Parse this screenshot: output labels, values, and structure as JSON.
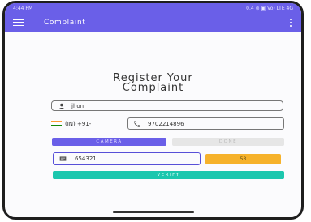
{
  "status_bar": {
    "time": "4:44 PM",
    "right": "0.4 ⊚ ▣ Vo) LTE 4G"
  },
  "app_bar": {
    "title": "Complaint"
  },
  "heading": {
    "line1": "Register Your",
    "line2": "Complaint"
  },
  "name_field": {
    "value": "jhon"
  },
  "phone": {
    "country_prefix": "(IN) +91-",
    "value": "9702214896"
  },
  "buttons": {
    "camera": "CAMERA",
    "done": "DONE",
    "timer": "53",
    "verify": "VERIFY"
  },
  "otp_field": {
    "value": "654321"
  },
  "colors": {
    "primary": "#6a5fe8",
    "verify": "#1cc7ae",
    "timer": "#f6b22b"
  },
  "icons": [
    "menu-icon",
    "more-vert-icon",
    "person-icon",
    "india-flag-icon",
    "phone-icon",
    "otp-icon"
  ]
}
